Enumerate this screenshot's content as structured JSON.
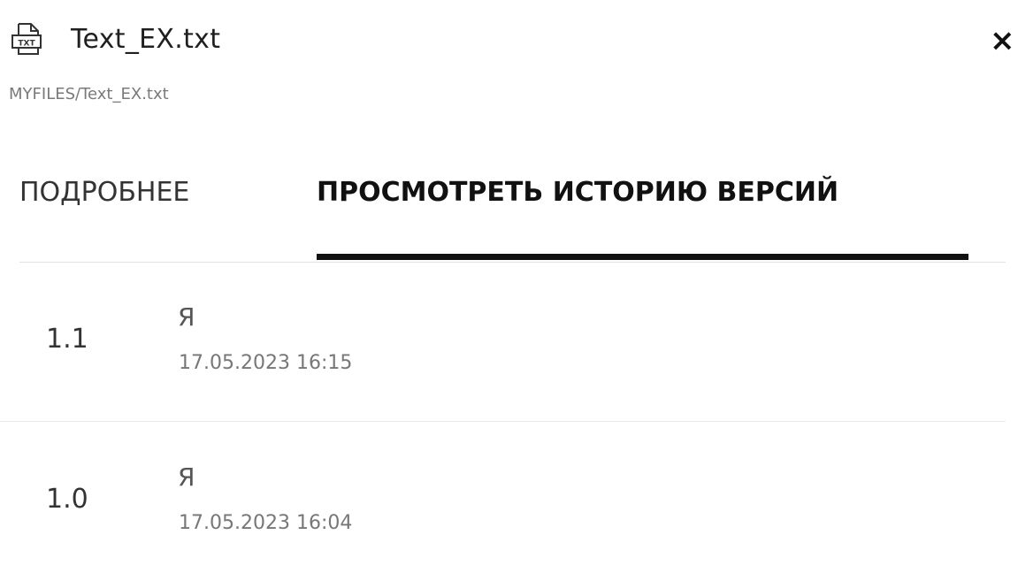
{
  "header": {
    "file_name": "Text_EX.txt",
    "file_icon": "txt-file-icon",
    "close_icon": "close-icon",
    "close_glyph": "×"
  },
  "path": "MYFILES/Text_EX.txt",
  "tabs": [
    {
      "label": "ПОДРОБНЕЕ",
      "active": false
    },
    {
      "label": "ПРОСМОТРЕТЬ ИСТОРИЮ ВЕРСИЙ",
      "active": true
    }
  ],
  "versions": [
    {
      "number": "1.1",
      "author": "Я",
      "date": "17.05.2023 16:15"
    },
    {
      "number": "1.0",
      "author": "Я",
      "date": "17.05.2023 16:04"
    }
  ]
}
